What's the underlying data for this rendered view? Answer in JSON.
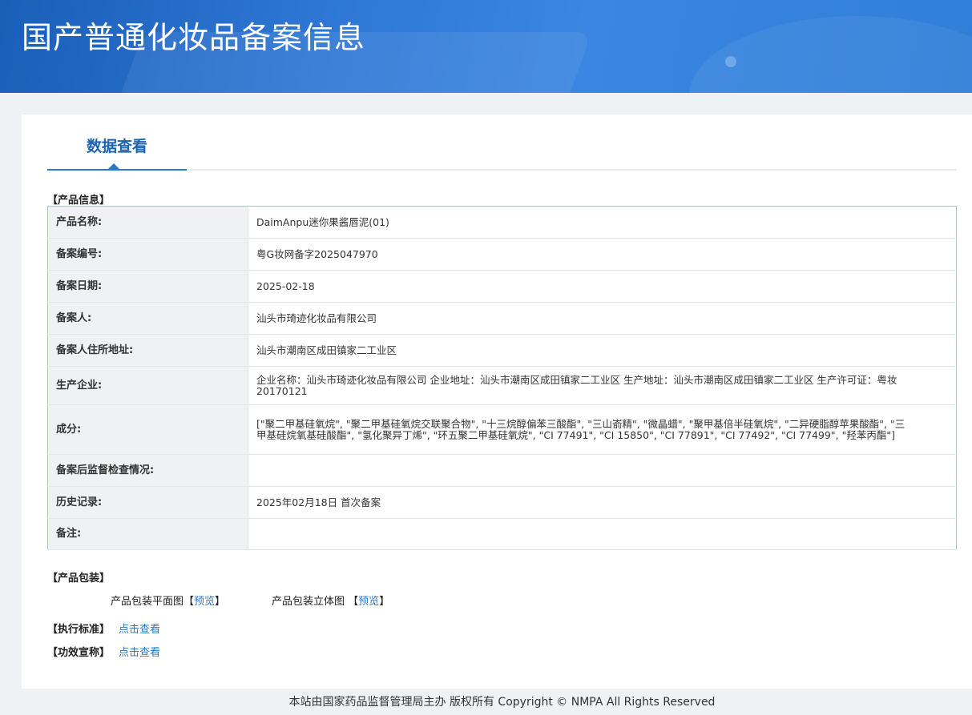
{
  "banner": {
    "title": "国产普通化妆品备案信息"
  },
  "tabs": {
    "active": "数据查看"
  },
  "sections": {
    "product_info": "【产品信息】",
    "packaging": "【产品包装】",
    "standard": "【执行标准】",
    "efficacy": "【功效宣称】"
  },
  "product_rows": [
    {
      "label": "产品名称:",
      "value": "DaimAnpu迷你果酱唇泥(01)"
    },
    {
      "label": "备案编号:",
      "value": "粤G妆网备字2025047970"
    },
    {
      "label": "备案日期:",
      "value": "2025-02-18"
    },
    {
      "label": "备案人:",
      "value": "汕头市琦迹化妆品有限公司"
    },
    {
      "label": "备案人住所地址:",
      "value": "汕头市潮南区成田镇家二工业区"
    },
    {
      "label": "生产企业:",
      "value": "企业名称：汕头市琦迹化妆品有限公司 企业地址：汕头市潮南区成田镇家二工业区 生产地址：汕头市潮南区成田镇家二工业区 生产许可证：粤妆20170121"
    },
    {
      "label": "成分:",
      "value": "[\"聚二甲基硅氧烷\", \"聚二甲基硅氧烷交联聚合物\", \"十三烷醇偏苯三酸酯\", \"三山嵛精\", \"微晶蜡\", \"聚甲基倍半硅氧烷\", \"二异硬脂醇苹果酸酯\", \"三甲基硅烷氧基硅酸酯\", \"氢化聚异丁烯\", \"环五聚二甲基硅氧烷\", \"CI 77491\", \"CI 15850\", \"CI 77891\", \"CI 77492\", \"CI 77499\", \"羟苯丙酯\"]"
    },
    {
      "label": "备案后监督检查情况:",
      "value": ""
    },
    {
      "label": "历史记录:",
      "value": "2025年02月18日 首次备案"
    },
    {
      "label": "备注:",
      "value": ""
    }
  ],
  "packaging": {
    "flat_label": "产品包装平面图",
    "flat_link": "预览",
    "solid_label": "产品包装立体图",
    "solid_link": "预览",
    "bracket_open": "【",
    "bracket_close": "】"
  },
  "standard_link": "点击查看",
  "efficacy_link": "点击查看",
  "footer": "本站由国家药品监督管理局主办 版权所有 Copyright © NMPA All Rights Reserved"
}
